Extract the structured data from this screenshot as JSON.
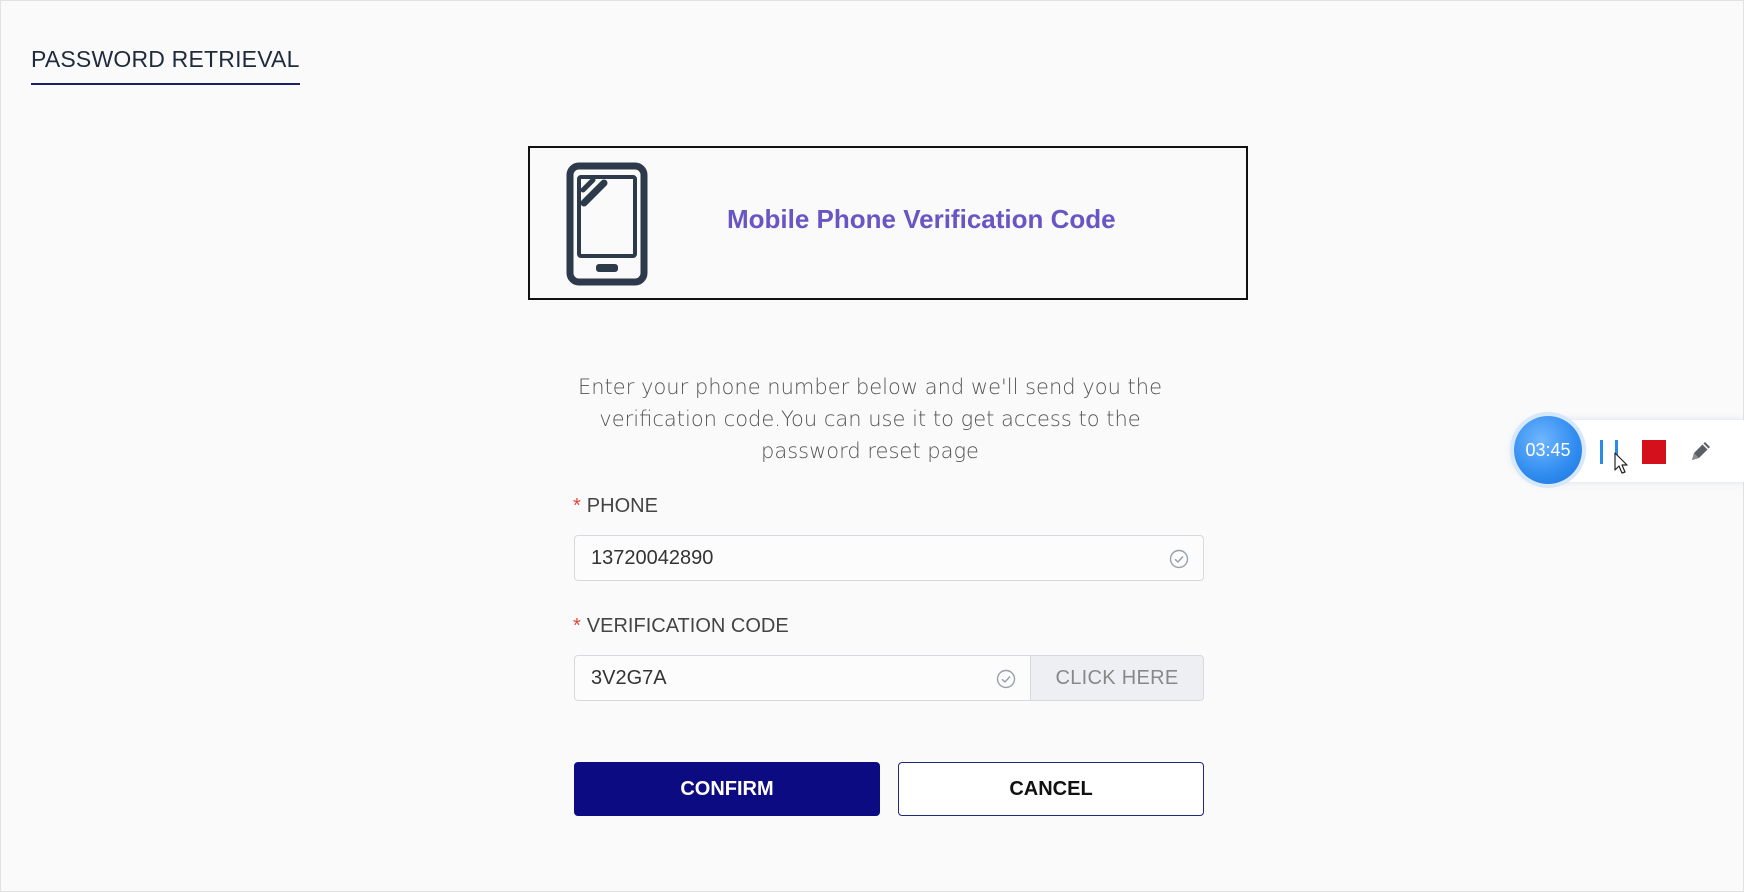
{
  "page": {
    "tab_title": "PASSWORD RETRIEVAL"
  },
  "hero": {
    "icon": "mobile-phone-icon",
    "title": "Mobile Phone Verification Code"
  },
  "intro": {
    "text": "Enter your phone number below and we'll send you the verification code.You can use it to get access to the password reset page"
  },
  "form": {
    "required_marker": "*",
    "phone": {
      "label": "PHONE",
      "value": "13720042890",
      "status_icon": "check-circle-icon"
    },
    "code": {
      "label": "VERIFICATION CODE",
      "value": "3V2G7A",
      "status_icon": "check-circle-icon",
      "send_button_label": "CLICK HERE"
    },
    "confirm_label": "CONFIRM",
    "cancel_label": "CANCEL"
  },
  "recorder": {
    "timer": "03:45",
    "pause_icon": "pause-icon",
    "stop_icon": "stop-icon",
    "pen_icon": "pen-icon"
  },
  "colors": {
    "accent_purple": "#6a55c4",
    "primary_navy": "#0c0b82",
    "required_red": "#e0453a",
    "recorder_blue": "#2f8bef",
    "recorder_stop_red": "#d3101c"
  }
}
